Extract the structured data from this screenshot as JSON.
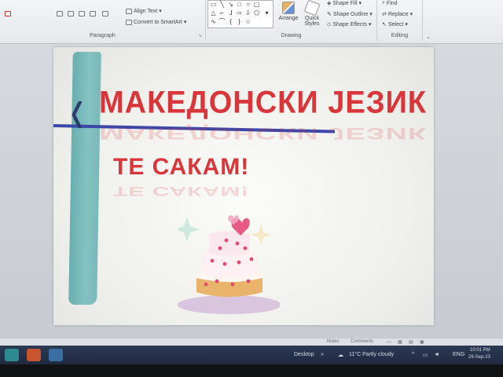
{
  "ribbon": {
    "paragraph": {
      "label": "Paragraph",
      "align_text": "Align Text",
      "convert_smartart": "Convert to SmartArt"
    },
    "drawing": {
      "label": "Drawing",
      "arrange": "Arrange",
      "quick_styles": "Quick Styles",
      "shape_fill": "Shape Fill",
      "shape_outline": "Shape Outline",
      "shape_effects": "Shape Effects"
    },
    "editing": {
      "label": "Editing",
      "find": "Find",
      "replace": "Replace",
      "select": "Select"
    }
  },
  "slide": {
    "title": "МАКЕДОНСКИ ЈЕЗИК",
    "subtitle": "ТЕ САКАМ!"
  },
  "statusbar": {
    "notes": "Notes",
    "comments": "Comments"
  },
  "taskbar": {
    "desktop_label": "Desktop",
    "weather": "11°C  Partly cloudy",
    "language": "ENG",
    "time": "10:01 PM",
    "date": "29-Sep-23"
  },
  "colors": {
    "title_red": "#d9363c",
    "band_teal": "#6fb3b5",
    "line_blue": "#3c47a8"
  }
}
